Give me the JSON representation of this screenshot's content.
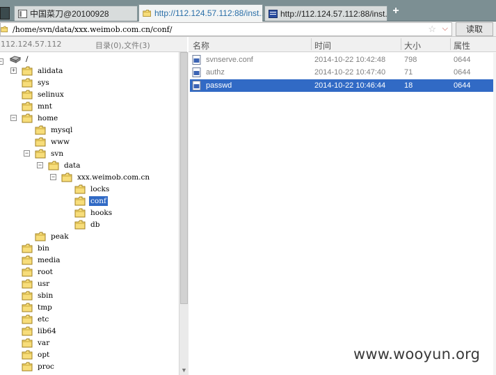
{
  "tabs": [
    {
      "label": "中国菜刀@20100928",
      "active": false
    },
    {
      "label": "http://112.124.57.112:88/inst...",
      "active": true
    },
    {
      "label": "http://112.124.57.112:88/inst...",
      "active": false
    }
  ],
  "new_tab_label": "+",
  "path_bar": {
    "path": "/home/svn/data/xxx.weimob.com.cn/conf/",
    "star": "☆",
    "dropdown": "⌵",
    "read_button": "读取"
  },
  "left_header": {
    "host": "112.124.57.112",
    "counts": "目录(0),文件(3)"
  },
  "tree": {
    "root": "/",
    "nodes": [
      {
        "label": "alidata",
        "expander": "+"
      },
      {
        "label": "sys"
      },
      {
        "label": "selinux"
      },
      {
        "label": "mnt"
      },
      {
        "label": "home",
        "expander": "−"
      },
      {
        "label": "mysql"
      },
      {
        "label": "www"
      },
      {
        "label": "svn",
        "expander": "−"
      },
      {
        "label": "data",
        "expander": "−"
      },
      {
        "label": "xxx.weimob.com.cn",
        "expander": "−"
      },
      {
        "label": "locks"
      },
      {
        "label": "conf",
        "selected": true
      },
      {
        "label": "hooks"
      },
      {
        "label": "db"
      },
      {
        "label": "peak"
      },
      {
        "label": "bin"
      },
      {
        "label": "media"
      },
      {
        "label": "root"
      },
      {
        "label": "usr"
      },
      {
        "label": "sbin"
      },
      {
        "label": "tmp"
      },
      {
        "label": "etc"
      },
      {
        "label": "lib64"
      },
      {
        "label": "var"
      },
      {
        "label": "opt"
      },
      {
        "label": "proc"
      }
    ]
  },
  "file_list": {
    "columns": [
      "名称",
      "时间",
      "大小",
      "属性"
    ],
    "rows": [
      {
        "name": "svnserve.conf",
        "time": "2014-10-22 10:42:48",
        "size": "798",
        "attr": "0644",
        "selected": false
      },
      {
        "name": "authz",
        "time": "2014-10-22 10:47:40",
        "size": "71",
        "attr": "0644",
        "selected": false
      },
      {
        "name": "passwd",
        "time": "2014-10-22 10:46:44",
        "size": "18",
        "attr": "0644",
        "selected": true
      }
    ]
  },
  "watermark": "www.wooyun.org",
  "colors": {
    "selection": "#316ac5",
    "tabbar": "#7c8f93",
    "folder": "#f5d66a"
  }
}
